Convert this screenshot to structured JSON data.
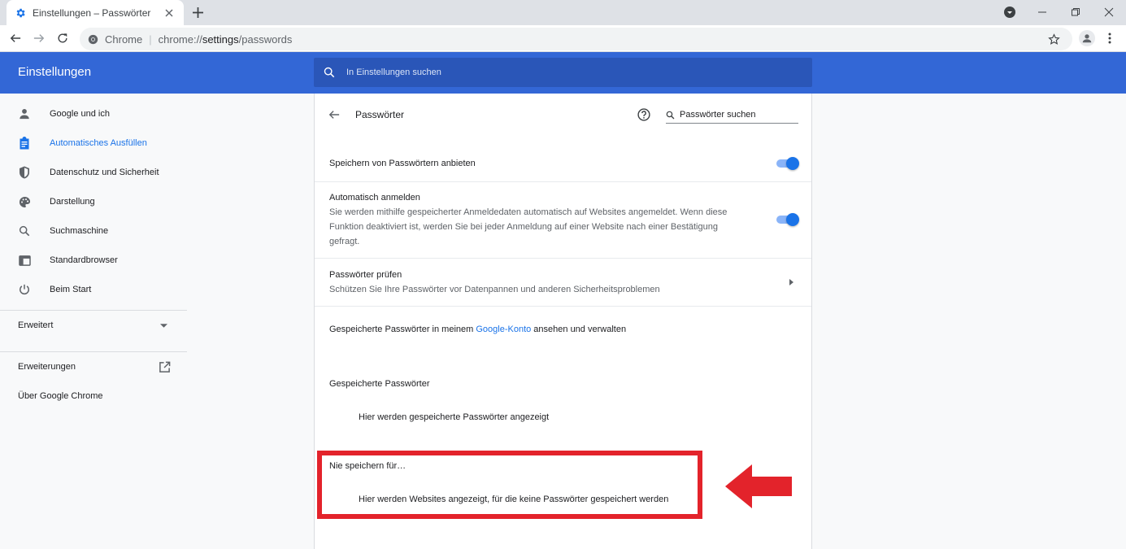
{
  "browser": {
    "tab_title": "Einstellungen – Passwörter",
    "site_label": "Chrome",
    "url_scheme": "chrome://",
    "url_host": "settings",
    "url_path": "/passwords"
  },
  "header": {
    "title": "Einstellungen",
    "search_placeholder": "In Einstellungen suchen"
  },
  "sidebar": {
    "items": [
      {
        "label": "Google und ich",
        "icon": "person-icon"
      },
      {
        "label": "Automatisches Ausfüllen",
        "icon": "clipboard-icon",
        "active": true
      },
      {
        "label": "Datenschutz und Sicherheit",
        "icon": "shield-icon"
      },
      {
        "label": "Darstellung",
        "icon": "palette-icon"
      },
      {
        "label": "Suchmaschine",
        "icon": "search-icon"
      },
      {
        "label": "Standardbrowser",
        "icon": "browser-window-icon"
      },
      {
        "label": "Beim Start",
        "icon": "power-icon"
      }
    ],
    "advanced": "Erweitert",
    "extensions": "Erweiterungen",
    "about": "Über Google Chrome"
  },
  "page": {
    "title": "Passwörter",
    "search_placeholder": "Passwörter suchen",
    "offer_save": {
      "label": "Speichern von Passwörtern anbieten",
      "enabled": true
    },
    "auto_signin": {
      "label": "Automatisch anmelden",
      "desc_line1": "Sie werden mithilfe gespeicherter Anmeldedaten automatisch auf Websites angemeldet. Wenn diese",
      "desc_line2": "Funktion deaktiviert ist, werden Sie bei jeder Anmeldung auf einer Website nach einer Bestätigung",
      "desc_line3": "gefragt.",
      "enabled": true
    },
    "check": {
      "label": "Passwörter prüfen",
      "desc": "Schützen Sie Ihre Passwörter vor Datenpannen und anderen Sicherheitsproblemen"
    },
    "account": {
      "prefix": "Gespeicherte Passwörter in meinem ",
      "link": "Google-Konto",
      "suffix": " ansehen und verwalten"
    },
    "saved": {
      "heading": "Gespeicherte Passwörter",
      "empty": "Hier werden gespeicherte Passwörter angezeigt"
    },
    "never": {
      "heading": "Nie speichern für…",
      "empty": "Hier werden Websites angezeigt, für die keine Passwörter gespeichert werden"
    }
  },
  "colors": {
    "header_blue": "#3367d6",
    "accent_blue": "#1a73e8",
    "annotation_red": "#e3232b"
  }
}
